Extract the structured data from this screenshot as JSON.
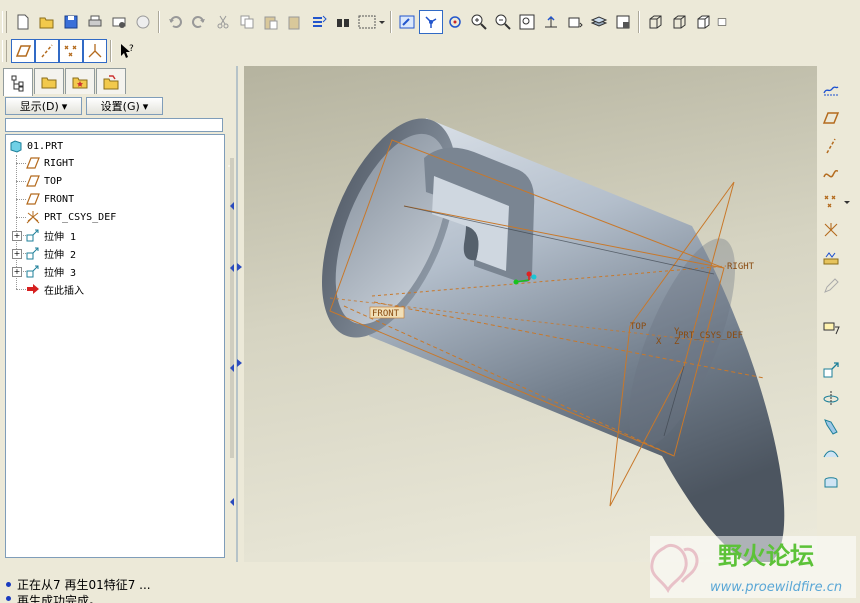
{
  "toolbar": {
    "row1_icons": [
      "new-file-icon",
      "open-folder-icon",
      "save-icon",
      "print-icon",
      "send-mail-icon",
      "email-icon",
      "undo-icon",
      "redo-icon",
      "cut-icon",
      "copy-icon",
      "paste-icon",
      "paste-special-icon",
      "regenerate-icon",
      "find-icon",
      "select-box-icon",
      "repaint-icon",
      "spin-center-icon",
      "orient-mode-icon",
      "zoom-in-icon",
      "zoom-out-icon",
      "refit-icon",
      "reorient-icon",
      "saved-views-icon",
      "layers-icon",
      "setup-icon",
      "wireframe-icon",
      "hidden-line-icon",
      "no-hidden-icon"
    ],
    "row2_icons": [
      "datum-plane-display-icon",
      "datum-axis-display-icon",
      "datum-point-display-icon",
      "csys-display-icon",
      "context-help-icon"
    ]
  },
  "navigator": {
    "tab_icons": [
      "model-tree-tab-icon",
      "folder-browser-tab-icon",
      "favorites-tab-icon",
      "connections-tab-icon"
    ],
    "show_menu": "显示(D)",
    "settings_menu": "设置(G)"
  },
  "model_tree": {
    "root": "01.PRT",
    "items": [
      {
        "label": "RIGHT",
        "icon": "datum-plane-icon",
        "expandable": false
      },
      {
        "label": "TOP",
        "icon": "datum-plane-icon",
        "expandable": false
      },
      {
        "label": "FRONT",
        "icon": "datum-plane-icon",
        "expandable": false
      },
      {
        "label": "PRT_CSYS_DEF",
        "icon": "coordinate-system-icon",
        "expandable": false
      },
      {
        "label": "拉伸 1",
        "icon": "extrude-feature-icon",
        "expandable": true
      },
      {
        "label": "拉伸 2",
        "icon": "extrude-feature-icon",
        "expandable": true
      },
      {
        "label": "拉伸 3",
        "icon": "extrude-feature-icon",
        "expandable": true
      },
      {
        "label": "在此插入",
        "icon": "insert-here-arrow-icon",
        "expandable": false
      }
    ]
  },
  "viewport": {
    "datum_labels": [
      "RIGHT",
      "FRONT",
      "TOP",
      "PRT_CSYS_DEF"
    ],
    "csys_axes": [
      "Y",
      "X",
      "Z"
    ],
    "colors": {
      "datum": "#c8782a",
      "body_light": "#c9d2dc",
      "body_dark": "#3e4650",
      "background_top": "#b5b39f",
      "background_bottom": "#edebdc"
    }
  },
  "right_toolbar": {
    "icons": [
      "sketch-tool-icon",
      "datum-plane-tool-icon",
      "datum-axis-tool-icon",
      "datum-curve-tool-icon",
      "datum-point-tool-icon",
      "csys-tool-icon",
      "analysis-feature-icon",
      "pencil-disabled-icon",
      "insert-annotation-icon",
      "extrude-tool-icon",
      "revolve-tool-icon",
      "sweep-tool-icon",
      "blend-tool-icon",
      "shell-tool-icon"
    ]
  },
  "status": {
    "messages": [
      "正在从7 再生01特征7 ...",
      "再生成功完成。"
    ]
  },
  "watermark": {
    "name": "野火论坛",
    "url": "www.proewildfire.cn"
  }
}
